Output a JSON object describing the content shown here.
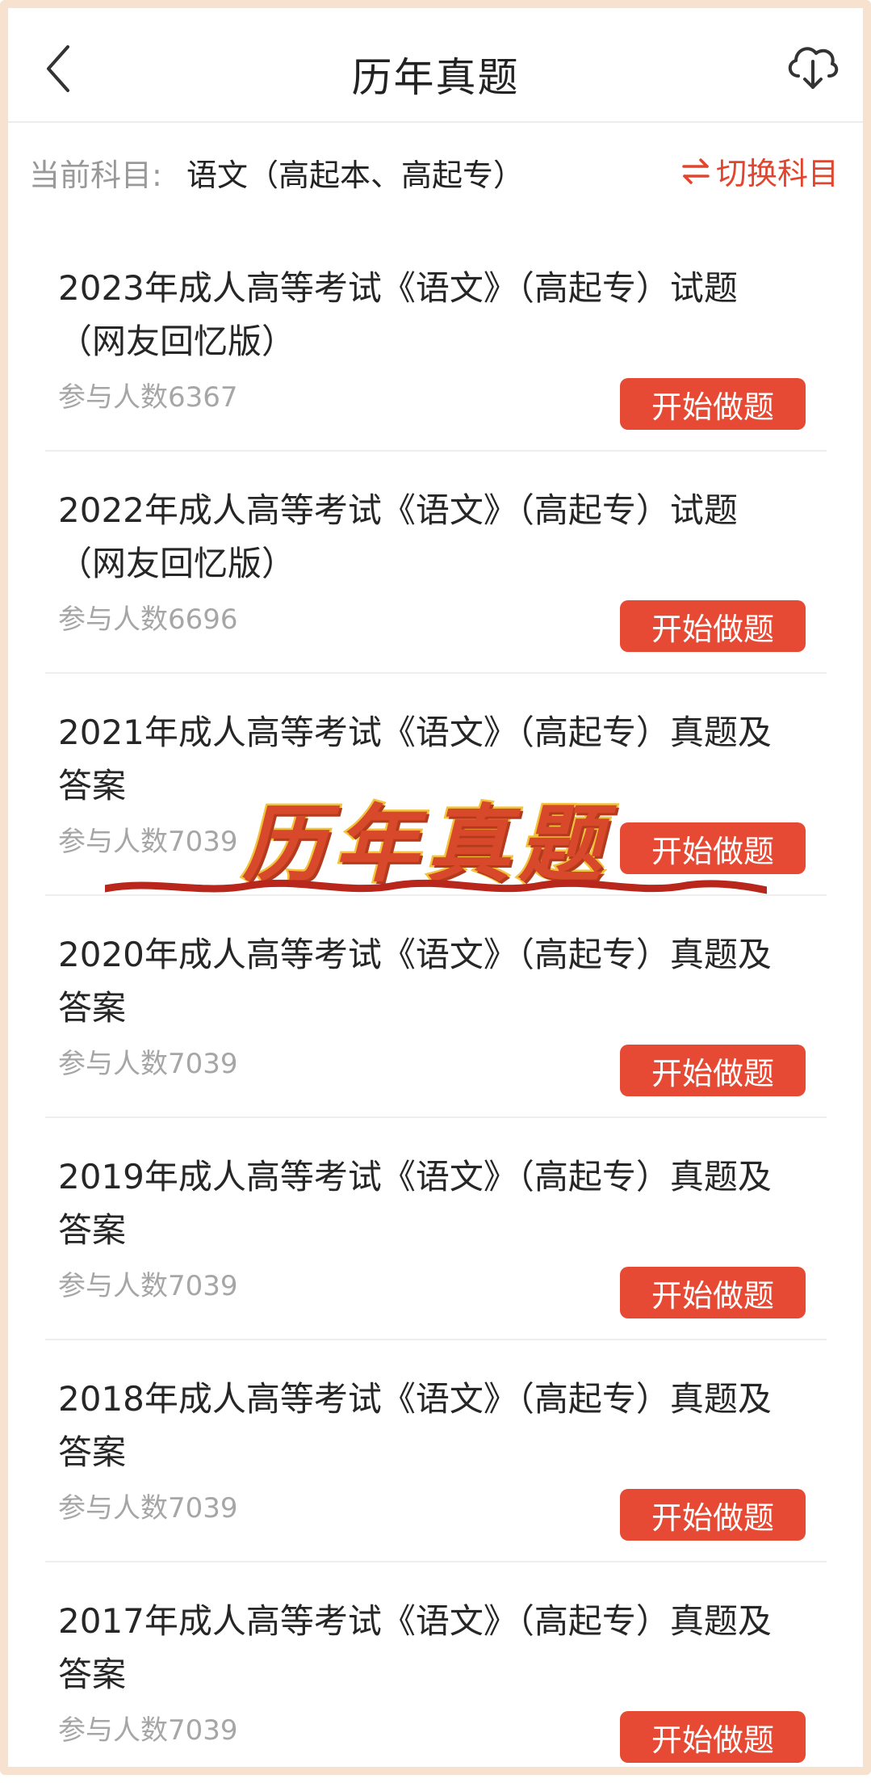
{
  "header": {
    "title": "历年真题"
  },
  "subject": {
    "label": "当前科目:",
    "value": "语文（高起本、高起专）",
    "switch_label": "切换科目"
  },
  "items": [
    {
      "title": "2023年成人高等考试《语文》（高起专）试题（网友回忆版）",
      "count": "参与人数6367",
      "button": "开始做题"
    },
    {
      "title": "2022年成人高等考试《语文》（高起专）试题（网友回忆版）",
      "count": "参与人数6696",
      "button": "开始做题"
    },
    {
      "title": "2021年成人高等考试《语文》（高起专）真题及答案",
      "count": "参与人数7039",
      "button": "开始做题"
    },
    {
      "title": "2020年成人高等考试《语文》（高起专）真题及答案",
      "count": "参与人数7039",
      "button": "开始做题"
    },
    {
      "title": "2019年成人高等考试《语文》（高起专）真题及答案",
      "count": "参与人数7039",
      "button": "开始做题"
    },
    {
      "title": "2018年成人高等考试《语文》（高起专）真题及答案",
      "count": "参与人数7039",
      "button": "开始做题"
    },
    {
      "title": "2017年成人高等考试《语文》（高起专）真题及答案",
      "count": "参与人数7039",
      "button": "开始做题"
    }
  ],
  "overlay": {
    "stamp_text": "历年真题"
  },
  "colors": {
    "accent": "#e74a34",
    "switch": "#e0462f",
    "stamp_fill": "#d8482a",
    "stamp_outline": "#f2c23a"
  },
  "icons": {
    "back": "chevron-left-icon",
    "download": "cloud-download-icon",
    "switch": "swap-arrows-icon"
  }
}
